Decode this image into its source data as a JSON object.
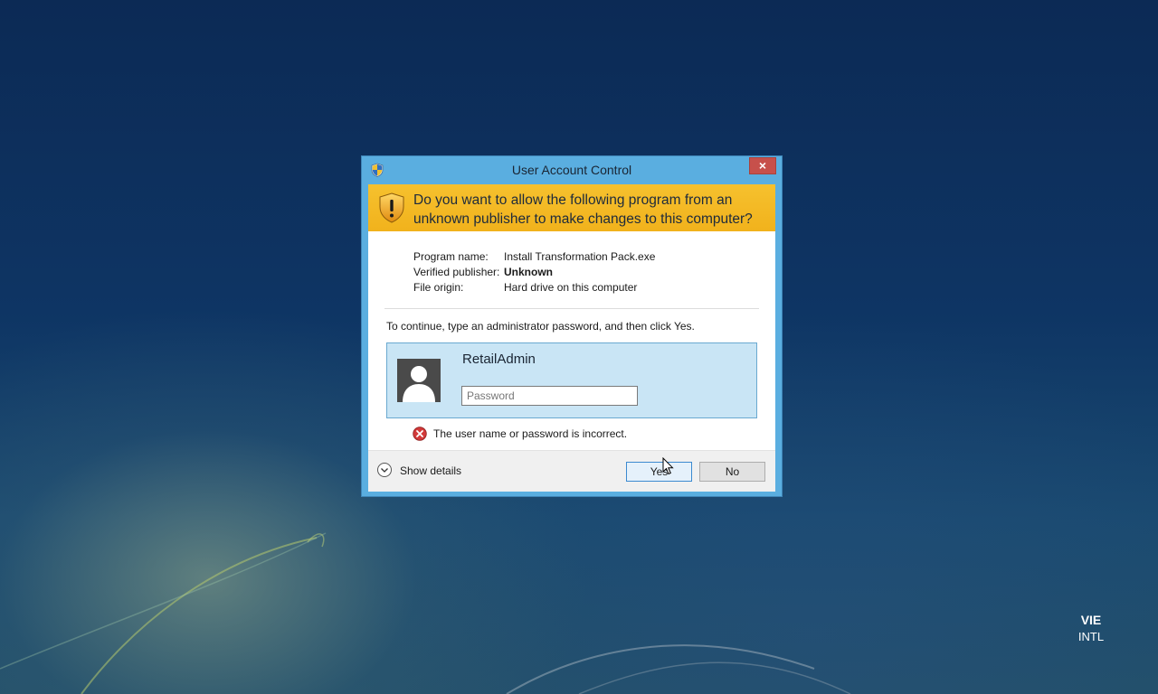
{
  "dialog": {
    "title": "User Account Control",
    "close_label": "×",
    "question": "Do you want to allow the following program from an unknown publisher to make changes to this computer?",
    "program": {
      "name_label": "Program name:",
      "name_value": "Install Transformation Pack.exe",
      "publisher_label": "Verified publisher:",
      "publisher_value": "Unknown",
      "origin_label": "File origin:",
      "origin_value": "Hard drive on this computer"
    },
    "instruction": "To continue, type an administrator password, and then click Yes.",
    "credential": {
      "user_name": "RetailAdmin",
      "password_placeholder": "Password",
      "password_value": ""
    },
    "error_message": "The user name or password is incorrect.",
    "show_details_label": "Show details",
    "yes_label": "Yes",
    "no_label": "No"
  },
  "taskbar_language": {
    "code": "VIE",
    "layout": "INTL"
  },
  "colors": {
    "dialog_frame": "#5aaee0",
    "warning_banner": "#f1b21c",
    "credential_box": "#c9e5f5",
    "close_button": "#c7504b",
    "error_icon": "#d23a3a"
  }
}
